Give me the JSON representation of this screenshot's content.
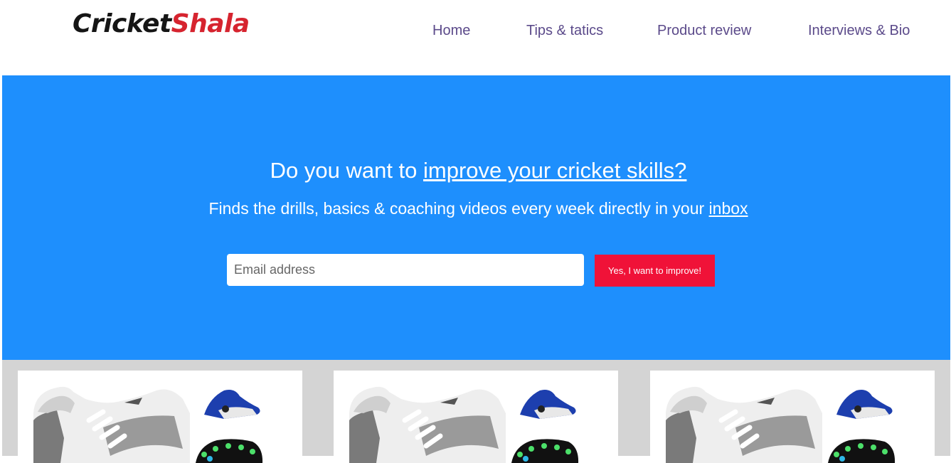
{
  "brand": {
    "logo_part1": "CricketS",
    "logo_part1_a": "Cr",
    "logo_part1_b": "icket",
    "logo_part2": "Shala",
    "colors": {
      "dark": "#151515",
      "red": "#d6242f"
    }
  },
  "nav": {
    "items": [
      {
        "label": "Home"
      },
      {
        "label": "Tips & tatics"
      },
      {
        "label": "Product review"
      },
      {
        "label": "Interviews & Bio"
      }
    ]
  },
  "hero": {
    "background": "#1e8ffd",
    "title_prefix": "Do you want to ",
    "title_link": "improve your cricket skills?",
    "subtitle_prefix": "Finds the drills, basics & coaching videos every week directly in your ",
    "subtitle_link": "inbox",
    "email_placeholder": "Email address",
    "button_label": "Yes, I want to improve!",
    "button_color": "#f01238"
  },
  "cards": [
    {
      "image": "cricket-shoes-image"
    },
    {
      "image": "cricket-shoes-image"
    },
    {
      "image": "cricket-shoes-image"
    }
  ]
}
